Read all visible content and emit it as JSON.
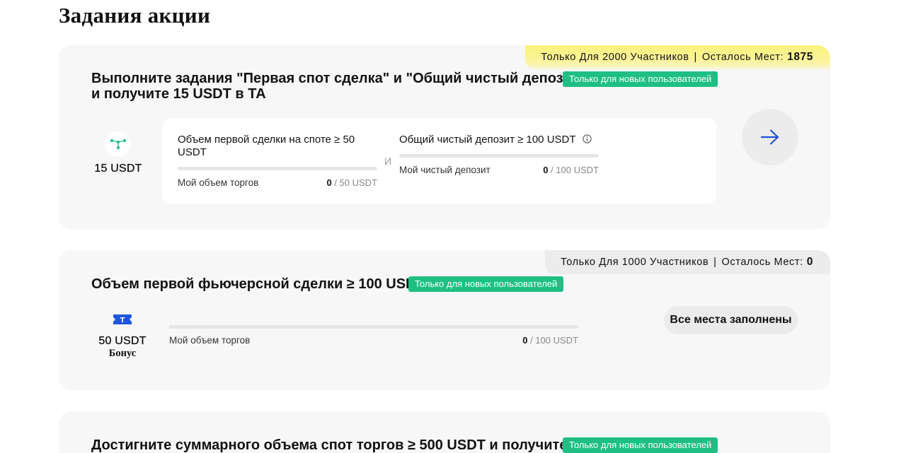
{
  "page": {
    "title": "Задания акции"
  },
  "tasks": [
    {
      "title_line1": "Выполните задания \"Первая спот сделка\" и \"Общий чистый депозит\"",
      "title_line2": "и получите 15 USDT в ТА",
      "badge": "Только для новых пользователей",
      "quota": {
        "prefix": "Только Для 2000 Участников",
        "sep": "|",
        "remaining_label": "Осталось Мест:",
        "remaining": "1875"
      },
      "reward": {
        "amount": "15 USDT",
        "icon": "network-icon"
      },
      "conditions": [
        {
          "label": "Объем первой сделки на споте ≥ 50 USDT",
          "progress_label": "Мой объем торгов",
          "current": "0",
          "target": "/ 50 USDT",
          "progress": 0
        },
        {
          "label": "Общий чистый депозит ≥ 100 USDT",
          "info_icon": "info-icon",
          "progress_label": "Мой чистый депозит",
          "current": "0",
          "target": "/ 100 USDT",
          "progress": 0
        }
      ],
      "connector": "И",
      "action_icon": "arrow-right-icon"
    },
    {
      "title": "Объем первой фьючерсной сделки ≥ 100 USDT",
      "badge": "Только для новых пользователей",
      "quota": {
        "prefix": "Только Для 1000 Участников",
        "sep": "|",
        "remaining_label": "Осталось Мест:",
        "remaining": "0"
      },
      "reward": {
        "amount": "50 USDT",
        "sub": "Бонус",
        "icon": "ticket-icon"
      },
      "progress_label": "Мой объем торгов",
      "current": "0",
      "target": "/ 100 USDT",
      "progress": 0,
      "action_label": "Все места заполнены"
    },
    {
      "title": "Достигните суммарного объема спот торгов ≥ 500 USDT и получите",
      "badge": "Только для новых пользователей"
    }
  ],
  "colors": {
    "accent_green": "#1fbf83",
    "quota_yellow": "#fbf27a",
    "arrow_blue": "#1e4fd6"
  }
}
